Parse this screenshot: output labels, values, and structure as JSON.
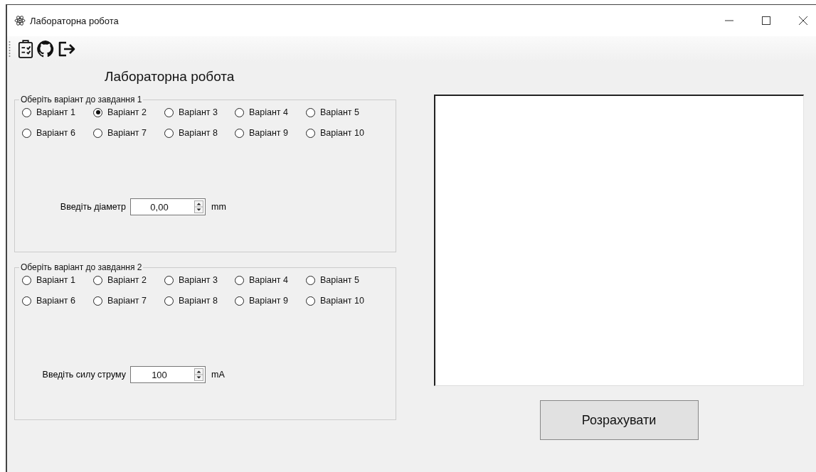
{
  "window": {
    "title": "Лабораторна робота"
  },
  "heading": "Лабораторна робота",
  "groups": [
    {
      "legend": "Оберіть варіант до завдання 1",
      "options": [
        {
          "label": "Варіант 1",
          "selected": false
        },
        {
          "label": "Варіант 2",
          "selected": true
        },
        {
          "label": "Варіант 3",
          "selected": false
        },
        {
          "label": "Варіант 4",
          "selected": false
        },
        {
          "label": "Варіант 5",
          "selected": false
        },
        {
          "label": "Варіант 6",
          "selected": false
        },
        {
          "label": "Варіант 7",
          "selected": false
        },
        {
          "label": "Варіант 8",
          "selected": false
        },
        {
          "label": "Варіант 9",
          "selected": false
        },
        {
          "label": "Варіант 10",
          "selected": false
        }
      ],
      "input": {
        "label": "Введіть діаметр",
        "value": "0,00",
        "unit": "mm"
      }
    },
    {
      "legend": "Оберіть варіант до завдання 2",
      "options": [
        {
          "label": "Варіант 1",
          "selected": false
        },
        {
          "label": "Варіант 2",
          "selected": false
        },
        {
          "label": "Варіант 3",
          "selected": false
        },
        {
          "label": "Варіант 4",
          "selected": false
        },
        {
          "label": "Варіант 5",
          "selected": false
        },
        {
          "label": "Варіант 6",
          "selected": false
        },
        {
          "label": "Варіант 7",
          "selected": false
        },
        {
          "label": "Варіант 8",
          "selected": false
        },
        {
          "label": "Варіант 9",
          "selected": false
        },
        {
          "label": "Варіант 10",
          "selected": false
        }
      ],
      "input": {
        "label": "Введіть силу струму",
        "value": "100",
        "unit": "mA"
      }
    }
  ],
  "button": "Розрахувати"
}
